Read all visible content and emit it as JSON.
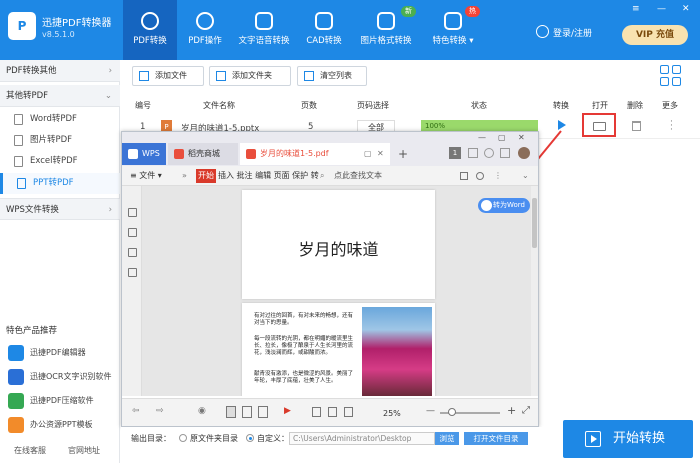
{
  "app": {
    "name": "迅捷PDF转换器",
    "version": "v8.5.1.0",
    "logo": "P"
  },
  "nav": [
    {
      "label": "PDF转换",
      "icon": "convert-icon",
      "active": true
    },
    {
      "label": "PDF操作",
      "icon": "gear-icon"
    },
    {
      "label": "文字语音转换",
      "icon": "audio-icon"
    },
    {
      "label": "CAD转换",
      "icon": "cad-icon"
    },
    {
      "label": "图片格式转换",
      "icon": "image-icon",
      "badge": "新"
    },
    {
      "label": "特色转换 ▾",
      "icon": "special-icon",
      "badge": "热"
    }
  ],
  "header": {
    "login": "登录/注册",
    "vip_label": "VIP 充值",
    "window_controls": [
      "≡",
      "—",
      "✕"
    ]
  },
  "sidebar": {
    "categories": [
      {
        "label": "PDF转换其他",
        "chevron": "›"
      },
      {
        "label": "其他转PDF",
        "chevron": "⌄"
      },
      {
        "label": "WPS文件转换",
        "chevron": "›"
      }
    ],
    "items": [
      {
        "label": "Word转PDF"
      },
      {
        "label": "图片转PDF"
      },
      {
        "label": "Excel转PDF"
      },
      {
        "label": "PPT转PDF",
        "active": true
      }
    ],
    "features_title": "特色产品推荐",
    "features": [
      {
        "label": "迅捷PDF编辑器",
        "color": "#1e88e5"
      },
      {
        "label": "迅捷OCR文字识别软件",
        "color": "#2a6fd6"
      },
      {
        "label": "迅捷PDF压缩软件",
        "color": "#35a853"
      },
      {
        "label": "办公资源PPT模板",
        "color": "#f28b2a"
      }
    ],
    "footer": {
      "service": "在线客服",
      "website": "官网地址"
    }
  },
  "toolbar": {
    "add_file": "添加文件",
    "add_folder": "添加文件夹",
    "clear_list": "清空列表"
  },
  "table": {
    "headers": {
      "index": "编号",
      "name": "文件名称",
      "pages": "页数",
      "page_select": "页码选择",
      "status": "状态",
      "convert": "转换",
      "open": "打开",
      "delete": "删除",
      "more": "更多"
    },
    "rows": [
      {
        "index": "1",
        "icon": "P",
        "name": "岁月的味道1-5.pptx",
        "pages": "5",
        "page_select": "全部",
        "progress": "100%",
        "progress_value": 1.0
      }
    ]
  },
  "pdf_viewer": {
    "tabs": [
      {
        "label": "WPS",
        "icon_color": "#3b74d6"
      },
      {
        "label": "稻壳商城",
        "icon_color": "#e94e3c"
      },
      {
        "label": "岁月的味道1-5.pdf",
        "icon_color": "#e94e3c"
      }
    ],
    "tab_controls": [
      "▢",
      "✕"
    ],
    "new_tab": "+",
    "window_controls": [
      "1",
      "—",
      "▢",
      "✕"
    ],
    "menu": {
      "file": "≡ 文件 ▾",
      "start": "开始",
      "items": "插入 批注 编辑 页面 保护 转",
      "search": "点此查找文本"
    },
    "page1_title": "岁月的味道",
    "page2_paragraphs": [
      "有对过往的回首，有对未来的畅想，还有对当下的思量。",
      "每一段流转的光阴，都在明媚的暖流里生长、拉长，像极了酿泉于人生长河里的流花，浅淡澜而辉，或甜酸而浓。",
      "献青没有激添，也是微涩的风景。美丽了年轮，丰厚了底蕴，壮美了人生。"
    ],
    "to_word": "转为Word",
    "zoom": "25%",
    "status_controls": {
      "prev": "⇦",
      "next": "⇨",
      "eye": "◉",
      "play": "▶",
      "zoom_out": "—",
      "zoom_in": "+",
      "fit": "⤢"
    }
  },
  "bottom": {
    "output_label": "输出目录：",
    "option_source": "原文件夹目录",
    "option_custom": "自定义：",
    "path": "C:\\Users\\Administrator\\Desktop",
    "browse": "浏览",
    "open_folder": "打开文件目录",
    "start": "开始转换"
  }
}
